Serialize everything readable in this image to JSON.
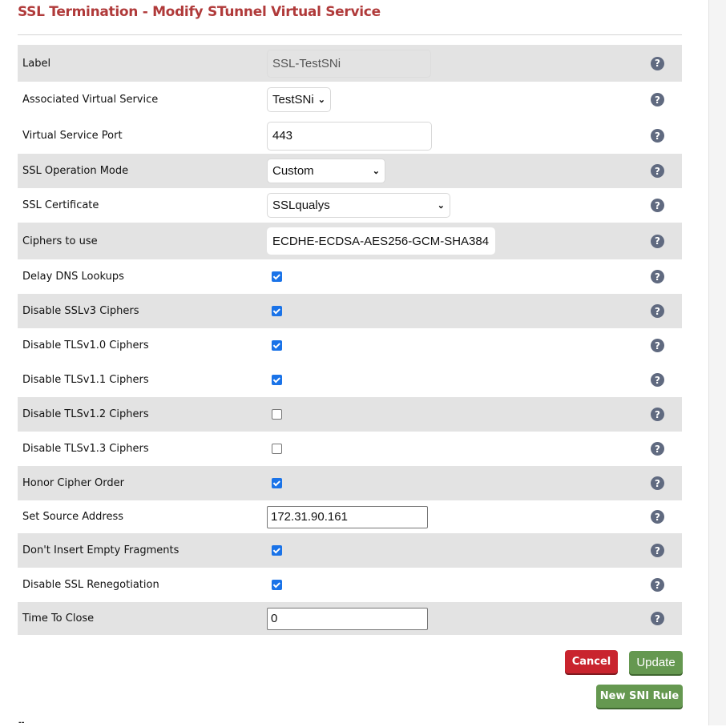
{
  "page": {
    "title": "SSL Termination - Modify STunnel Virtual Service",
    "footer_text": "--"
  },
  "form": {
    "rows": [
      {
        "label": "Label",
        "type": "text-readonly",
        "value": "SSL-TestSNi",
        "help_icon": "question-circle-icon"
      },
      {
        "label": "Associated Virtual Service",
        "type": "select",
        "value": "TestSNi",
        "help_icon": "question-circle-icon"
      },
      {
        "label": "Virtual Service Port",
        "type": "text",
        "value": "443",
        "help_icon": "question-circle-icon"
      },
      {
        "label": "SSL Operation Mode",
        "type": "select",
        "value": "Custom",
        "help_icon": "question-circle-icon"
      },
      {
        "label": "SSL Certificate",
        "type": "select",
        "value": "SSLqualys",
        "help_icon": "question-circle-icon"
      },
      {
        "label": "Ciphers to use",
        "type": "text",
        "value": "ECDHE-ECDSA-AES256-GCM-SHA384:",
        "help_icon": "question-circle-icon"
      },
      {
        "label": "Delay DNS Lookups",
        "type": "checkbox",
        "checked": true,
        "help_icon": "question-circle-icon"
      },
      {
        "label": "Disable SSLv3 Ciphers",
        "type": "checkbox",
        "checked": true,
        "help_icon": "question-circle-icon"
      },
      {
        "label": "Disable TLSv1.0 Ciphers",
        "type": "checkbox",
        "checked": true,
        "help_icon": "question-circle-icon"
      },
      {
        "label": "Disable TLSv1.1 Ciphers",
        "type": "checkbox",
        "checked": true,
        "help_icon": "question-circle-icon"
      },
      {
        "label": "Disable TLSv1.2 Ciphers",
        "type": "checkbox",
        "checked": false,
        "help_icon": "question-circle-icon"
      },
      {
        "label": "Disable TLSv1.3 Ciphers",
        "type": "checkbox",
        "checked": false,
        "help_icon": "question-circle-icon"
      },
      {
        "label": "Honor Cipher Order",
        "type": "checkbox",
        "checked": true,
        "help_icon": "question-circle-icon"
      },
      {
        "label": "Set Source Address",
        "type": "text-plain",
        "value": "172.31.90.161",
        "help_icon": "question-circle-icon"
      },
      {
        "label": "Don't Insert Empty Fragments",
        "type": "checkbox",
        "checked": true,
        "help_icon": "question-circle-icon"
      },
      {
        "label": "Disable SSL Renegotiation",
        "type": "checkbox",
        "checked": true,
        "help_icon": "question-circle-icon"
      },
      {
        "label": "Time To Close",
        "type": "text-plain",
        "value": "0",
        "help_icon": "question-circle-icon"
      }
    ],
    "help_glyph": "?"
  },
  "buttons": {
    "cancel": "Cancel",
    "update": "Update",
    "new_sni_rule": "New SNI Rule"
  },
  "colors": {
    "title": "#b03a3a",
    "cancel": "#c9242e",
    "update": "#659850",
    "checkbox": "#1a73e8",
    "help_icon": "#606a80",
    "row_shade": "#e3e3e3"
  }
}
